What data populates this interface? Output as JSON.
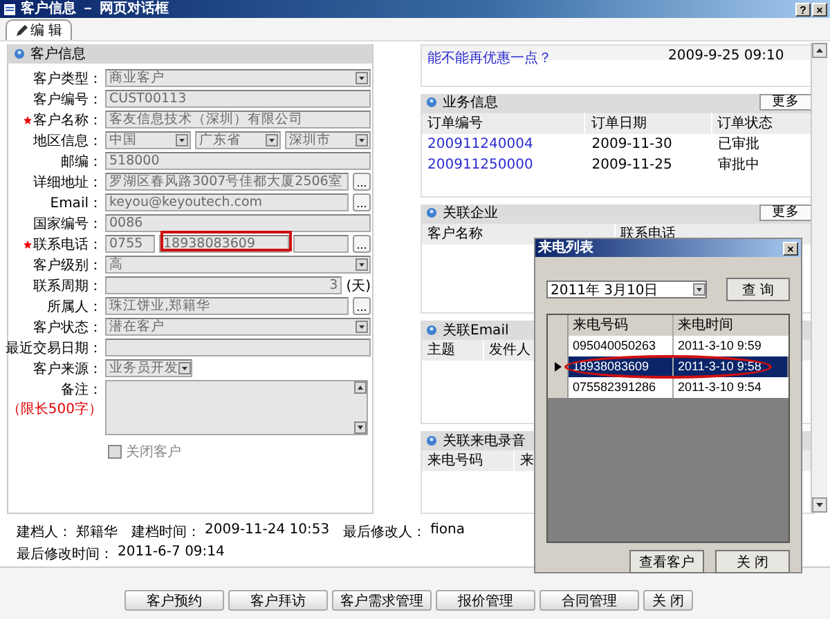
{
  "window": {
    "title": "客户信息 － 网页对话框",
    "help": "?",
    "close": "×"
  },
  "edit_tab": {
    "label": "编 辑",
    "selected": true
  },
  "customer_panel": {
    "title": "客户信息",
    "fields": [
      {
        "kind": "select",
        "label": "客户类型：",
        "value": "商业客户"
      },
      {
        "kind": "text",
        "label": "客户编号：",
        "value": "CUST00113"
      },
      {
        "kind": "text",
        "label": "客户名称：",
        "value": "客友信息技术（深圳）有限公司",
        "required": true
      },
      {
        "kind": "region",
        "label": "地区信息：",
        "values": [
          "中国",
          "广东省",
          "深圳市"
        ]
      },
      {
        "kind": "text",
        "label": "邮编：",
        "value": "518000"
      },
      {
        "kind": "lookup",
        "label": "详细地址：",
        "value": "罗湖区春风路3007号佳都大厦2506室",
        "button": "..."
      },
      {
        "kind": "lookup",
        "label": "Email：",
        "value": "keyou@keyoutech.com",
        "button": "..."
      },
      {
        "kind": "text",
        "label": "国家编号：",
        "value": "0086"
      },
      {
        "kind": "phone",
        "label": "联系电话：",
        "values": [
          "0755",
          "18938083609"
        ],
        "button": "...",
        "required": true,
        "highlighted": true
      },
      {
        "kind": "select",
        "label": "客户级别：",
        "value": "高"
      },
      {
        "kind": "days",
        "label": "联系周期：",
        "value": "3",
        "unit": "(天)"
      },
      {
        "kind": "lookup",
        "label": "所属人：",
        "value": "珠江饼业,郑籍华",
        "button": "..."
      },
      {
        "kind": "select",
        "label": "客户状态：",
        "value": "潜在客户"
      },
      {
        "kind": "text",
        "label": "最近交易日期："
      },
      {
        "kind": "short_select",
        "label": "客户来源：",
        "value": "业务员开发"
      },
      {
        "kind": "textarea",
        "label": "备注：",
        "note": "（限长500字）"
      },
      {
        "kind": "checkbox",
        "label": "关闭客户",
        "checked": false
      }
    ]
  },
  "record_info": [
    {
      "label": "建档人：",
      "value": "郑籍华"
    },
    {
      "label": "建档时间：",
      "value": "2009-11-24 10:53"
    },
    {
      "label": "最后修改人：",
      "value": "fiona"
    },
    {
      "label": "最后修改时间：",
      "value": "2011-6-7 09:14"
    }
  ],
  "message": {
    "text": "能不能再优惠一点？",
    "time": "2009-9-25 09:10"
  },
  "sections": [
    {
      "title": "业务信息",
      "more": "更多",
      "columns": [
        "订单编号",
        "订单日期",
        "订单状态"
      ],
      "rows": [
        [
          "200911240004",
          "2009-11-30",
          "已审批"
        ],
        [
          "200911250000",
          "2009-11-25",
          "审批中"
        ]
      ]
    },
    {
      "title": "关联企业",
      "more": "更多",
      "columns": [
        "客户名称",
        "联系电话"
      ]
    },
    {
      "title": "关联Email",
      "columns": [
        "主题",
        "发件人"
      ]
    },
    {
      "title": "关联来电录音",
      "columns": [
        "来电号码",
        "来"
      ]
    }
  ],
  "call_dialog": {
    "title": "来电列表",
    "close": "×",
    "date": "2011年 3月10日",
    "query": "查 询",
    "columns": [
      "来电号码",
      "来电时间"
    ],
    "rows": [
      {
        "number": "095040050263",
        "time": "2011-3-10 9:59",
        "selected": false
      },
      {
        "number": "18938083609",
        "time": "2011-3-10 9:58",
        "selected": true,
        "highlighted": true
      },
      {
        "number": "075582391286",
        "time": "2011-3-10 9:54",
        "selected": false
      }
    ],
    "buttons": [
      "查看客户",
      "关 闭"
    ]
  },
  "buttons": [
    "客户预约",
    "客户拜访",
    "客户需求管理",
    "报价管理",
    "合同管理",
    "关 闭"
  ]
}
